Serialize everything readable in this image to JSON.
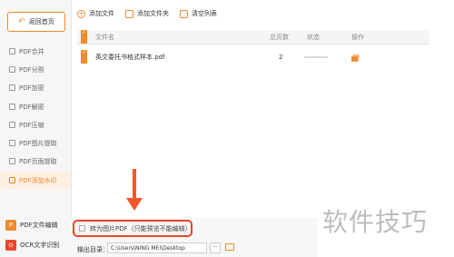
{
  "sidebar": {
    "back_label": "返回首页",
    "items": [
      {
        "label": "PDF合并"
      },
      {
        "label": "PDF分割"
      },
      {
        "label": "PDF加密"
      },
      {
        "label": "PDF解密"
      },
      {
        "label": "PDF压缩"
      },
      {
        "label": "PDF图片提取"
      },
      {
        "label": "PDF页面提取"
      },
      {
        "label": "PDF添加水印"
      }
    ],
    "bottom": [
      {
        "label": "PDF文件编辑",
        "badge": "P"
      },
      {
        "label": "OCR文字识别",
        "badge": "⊙"
      }
    ]
  },
  "toolbar": {
    "add_file": "添加文件",
    "add_folder": "添加文件夹",
    "clear_list": "清空列表"
  },
  "table": {
    "headers": [
      "文件名",
      "总页数",
      "状态",
      "操作"
    ],
    "rows": [
      {
        "name": "英文委托书格式样本.pdf",
        "pages": "2"
      }
    ]
  },
  "options": {
    "convert_label": "转为图片PDF（只能预览不能编辑）",
    "output_label": "输出目录：",
    "output_path": "C:\\Users\\NING MEI\\Desktop",
    "browse": "···"
  },
  "watermark": "软件技巧",
  "colors": {
    "accent": "#f08a2c",
    "highlight": "#e8452c"
  }
}
